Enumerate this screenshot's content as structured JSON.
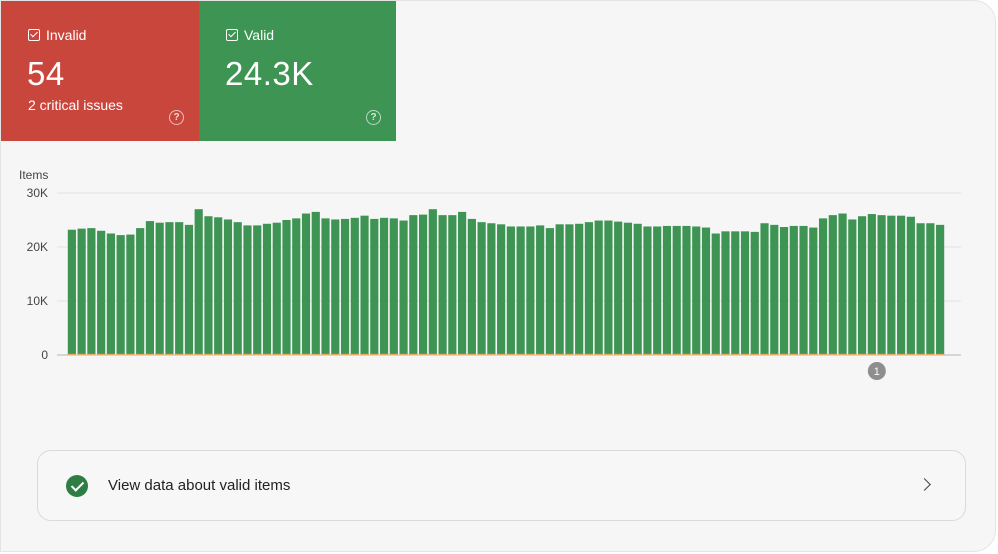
{
  "tiles": {
    "invalid": {
      "label": "Invalid",
      "value": "54",
      "sub": "2 critical issues",
      "color": "#c9463d"
    },
    "valid": {
      "label": "Valid",
      "value": "24.3K",
      "color": "#3d9453"
    }
  },
  "help_symbol": "?",
  "chart_data": {
    "type": "bar",
    "ylabel": "Items",
    "ylim": [
      0,
      30000
    ],
    "yticks": [
      {
        "value": 0,
        "label": "0"
      },
      {
        "value": 10000,
        "label": "10K"
      },
      {
        "value": 20000,
        "label": "20K"
      },
      {
        "value": 30000,
        "label": "30K"
      }
    ],
    "grid": true,
    "series": [
      {
        "color": "#3d9453",
        "values": [
          23200,
          23400,
          23500,
          23000,
          22500,
          22200,
          22300,
          23500,
          24800,
          24500,
          24600,
          24600,
          24100,
          27000,
          25700,
          25500,
          25100,
          24600,
          24000,
          24000,
          24300,
          24500,
          25000,
          25300,
          26200,
          26500,
          25300,
          25100,
          25200,
          25400,
          25800,
          25200,
          25400,
          25300,
          24900,
          25900,
          26000,
          27000,
          25900,
          25900,
          26500,
          25200,
          24600,
          24400,
          24200,
          23800,
          23800,
          23800,
          24000,
          23500,
          24200,
          24200,
          24300,
          24600,
          24900,
          24900,
          24700,
          24500,
          24300,
          23800,
          23800,
          23900,
          23900,
          23900,
          23800,
          23600,
          22500,
          22900,
          22900,
          22900,
          22800,
          24400,
          24100,
          23700,
          23900,
          23900,
          23600,
          25300,
          25900,
          26200,
          25100,
          25700,
          26100,
          25900,
          25800,
          25800,
          25600,
          24400,
          24400,
          24100
        ]
      },
      {
        "color": "#c9463d",
        "values": [
          54,
          54,
          54,
          54,
          54,
          54,
          54,
          54,
          54,
          54,
          54,
          54,
          54,
          54,
          54,
          54,
          54,
          54,
          54,
          54,
          54,
          54,
          54,
          54,
          54,
          54,
          54,
          54,
          54,
          54,
          54,
          54,
          54,
          54,
          54,
          54,
          54,
          54,
          54,
          54,
          54,
          54,
          54,
          54,
          54,
          54,
          54,
          54,
          54,
          54,
          54,
          54,
          54,
          54,
          54,
          54,
          54,
          54,
          54,
          54,
          54,
          54,
          54,
          54,
          54,
          54,
          54,
          54,
          54,
          54,
          54,
          54,
          54,
          54,
          54,
          54,
          54,
          54,
          54,
          54,
          54,
          54,
          54,
          54,
          54,
          54,
          54,
          54,
          54,
          54
        ]
      }
    ],
    "annotations": [
      {
        "label": "1",
        "index": 82
      }
    ]
  },
  "panel": {
    "text": "View data about valid items"
  }
}
